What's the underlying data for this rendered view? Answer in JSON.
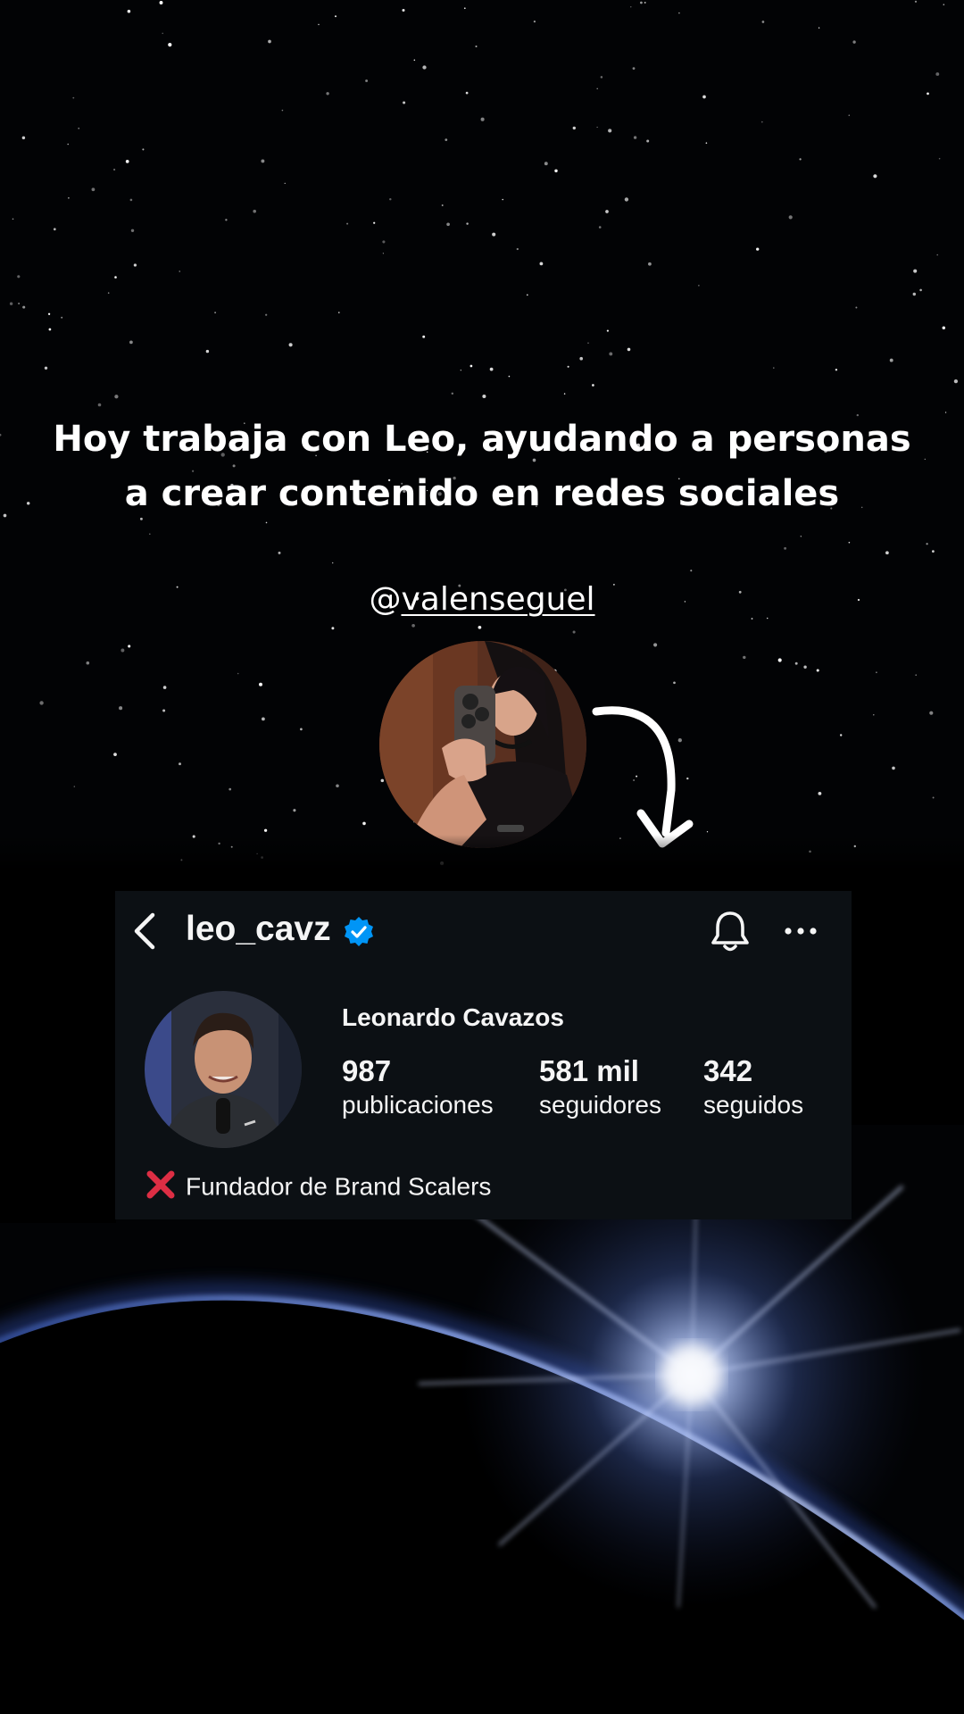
{
  "headline": {
    "line1": "Hoy trabaja con Leo, ayudando a personas",
    "line2": "a crear contenido en redes sociales"
  },
  "creator": {
    "at": "@",
    "handle": "valenseguel",
    "avatar_icon": "selfie-photo"
  },
  "profile": {
    "username": "leo_cavz",
    "verified": true,
    "full_name": "Leonardo Cavazos",
    "stats": [
      {
        "count": "987",
        "label": "publicaciones"
      },
      {
        "count": "581 mil",
        "label": "seguidores"
      },
      {
        "count": "342",
        "label": "seguidos"
      }
    ],
    "bio": "Fundador de Brand Scalers",
    "bio_icon": "red-x-icon",
    "icons": {
      "back": "chevron-left-icon",
      "bell": "bell-icon",
      "more": "ellipsis-icon"
    }
  },
  "colors": {
    "card_background": "#0c1014",
    "verified_blue": "#0095f6",
    "bio_icon_red": "#dd2e44",
    "glow_blue": "#5a7fd6"
  }
}
